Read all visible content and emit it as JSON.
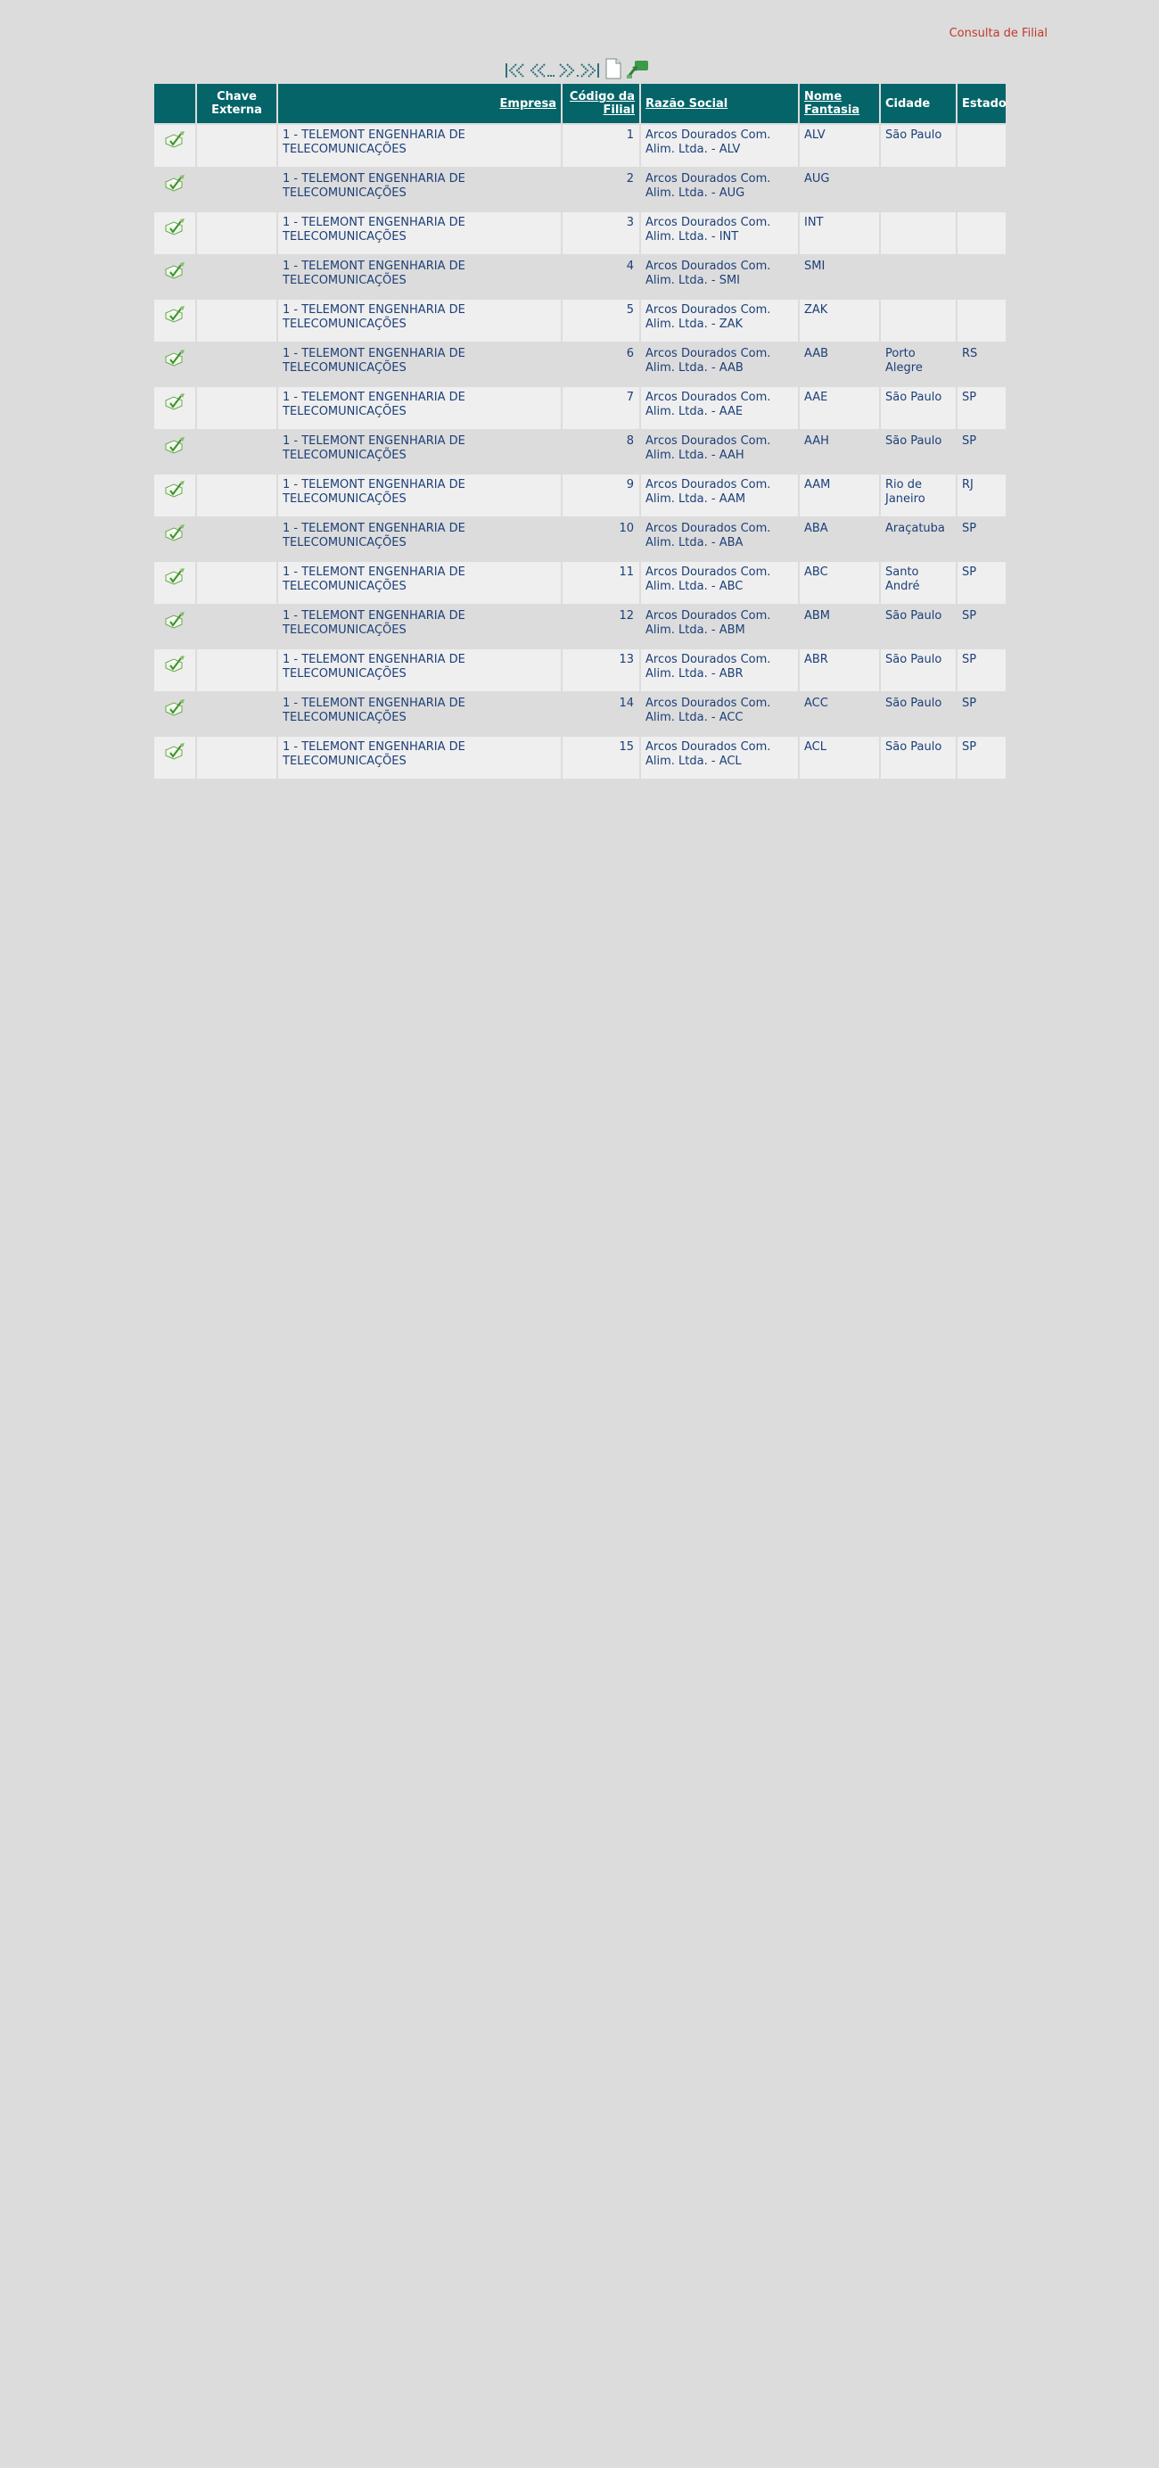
{
  "page_title": "Consulta de Filial",
  "pager": {
    "first": "first-page-icon",
    "prev": "previous-page-icon",
    "next": "next-page-icon",
    "last": "last-page-icon",
    "new_doc": "new-document-icon",
    "export": "export-icon"
  },
  "colors": {
    "header_bg": "#046468",
    "row_odd": "#efefef",
    "row_even": "#dcdcdc",
    "text": "#1c3f78",
    "title": "#c0392b"
  },
  "columns": [
    "",
    "Chave Externa",
    "Empresa",
    "Código da Filial",
    "Razão Social",
    "Nome Fantasia",
    "Cidade",
    "Estado"
  ],
  "rows": [
    {
      "chave": "",
      "empresa": "1 - TELEMONT ENGENHARIA DE TELECOMUNICAÇÕES",
      "codigo": "1",
      "razao": "Arcos Dourados Com. Alim. Ltda. - ALV",
      "fantasia": "ALV",
      "cidade": "São Paulo",
      "estado": ""
    },
    {
      "chave": "",
      "empresa": "1 - TELEMONT ENGENHARIA DE TELECOMUNICAÇÕES",
      "codigo": "2",
      "razao": "Arcos Dourados Com. Alim. Ltda. - AUG",
      "fantasia": "AUG",
      "cidade": "",
      "estado": ""
    },
    {
      "chave": "",
      "empresa": "1 - TELEMONT ENGENHARIA DE TELECOMUNICAÇÕES",
      "codigo": "3",
      "razao": "Arcos Dourados Com. Alim. Ltda. - INT",
      "fantasia": "INT",
      "cidade": "",
      "estado": ""
    },
    {
      "chave": "",
      "empresa": "1 - TELEMONT ENGENHARIA DE TELECOMUNICAÇÕES",
      "codigo": "4",
      "razao": "Arcos Dourados Com. Alim. Ltda. - SMI",
      "fantasia": "SMI",
      "cidade": "",
      "estado": ""
    },
    {
      "chave": "",
      "empresa": "1 - TELEMONT ENGENHARIA DE TELECOMUNICAÇÕES",
      "codigo": "5",
      "razao": "Arcos Dourados Com. Alim. Ltda. - ZAK",
      "fantasia": "ZAK",
      "cidade": "",
      "estado": ""
    },
    {
      "chave": "",
      "empresa": "1 - TELEMONT ENGENHARIA DE TELECOMUNICAÇÕES",
      "codigo": "6",
      "razao": "Arcos Dourados Com. Alim. Ltda. - AAB",
      "fantasia": "AAB",
      "cidade": "Porto Alegre",
      "estado": "RS"
    },
    {
      "chave": "",
      "empresa": "1 - TELEMONT ENGENHARIA DE TELECOMUNICAÇÕES",
      "codigo": "7",
      "razao": "Arcos Dourados Com. Alim. Ltda. - AAE",
      "fantasia": "AAE",
      "cidade": "São Paulo",
      "estado": "SP"
    },
    {
      "chave": "",
      "empresa": "1 - TELEMONT ENGENHARIA DE TELECOMUNICAÇÕES",
      "codigo": "8",
      "razao": "Arcos Dourados Com. Alim. Ltda. - AAH",
      "fantasia": "AAH",
      "cidade": "São Paulo",
      "estado": "SP"
    },
    {
      "chave": "",
      "empresa": "1 - TELEMONT ENGENHARIA DE TELECOMUNICAÇÕES",
      "codigo": "9",
      "razao": "Arcos Dourados Com. Alim. Ltda. - AAM",
      "fantasia": "AAM",
      "cidade": "Rio de Janeiro",
      "estado": "RJ"
    },
    {
      "chave": "",
      "empresa": "1 - TELEMONT ENGENHARIA DE TELECOMUNICAÇÕES",
      "codigo": "10",
      "razao": "Arcos Dourados Com. Alim. Ltda. - ABA",
      "fantasia": "ABA",
      "cidade": "Araçatuba",
      "estado": "SP"
    },
    {
      "chave": "",
      "empresa": "1 - TELEMONT ENGENHARIA DE TELECOMUNICAÇÕES",
      "codigo": "11",
      "razao": "Arcos Dourados Com. Alim. Ltda. - ABC",
      "fantasia": "ABC",
      "cidade": "Santo André",
      "estado": "SP"
    },
    {
      "chave": "",
      "empresa": "1 - TELEMONT ENGENHARIA DE TELECOMUNICAÇÕES",
      "codigo": "12",
      "razao": "Arcos Dourados Com. Alim. Ltda. - ABM",
      "fantasia": "ABM",
      "cidade": "São Paulo",
      "estado": "SP"
    },
    {
      "chave": "",
      "empresa": "1 - TELEMONT ENGENHARIA DE TELECOMUNICAÇÕES",
      "codigo": "13",
      "razao": "Arcos Dourados Com. Alim. Ltda. - ABR",
      "fantasia": "ABR",
      "cidade": "São Paulo",
      "estado": "SP"
    },
    {
      "chave": "",
      "empresa": "1 - TELEMONT ENGENHARIA DE TELECOMUNICAÇÕES",
      "codigo": "14",
      "razao": "Arcos Dourados Com. Alim. Ltda. - ACC",
      "fantasia": "ACC",
      "cidade": "São Paulo",
      "estado": "SP"
    },
    {
      "chave": "",
      "empresa": "1 - TELEMONT ENGENHARIA DE TELECOMUNICAÇÕES",
      "codigo": "15",
      "razao": "Arcos Dourados Com. Alim. Ltda. - ACL",
      "fantasia": "ACL",
      "cidade": "São Paulo",
      "estado": "SP"
    }
  ]
}
